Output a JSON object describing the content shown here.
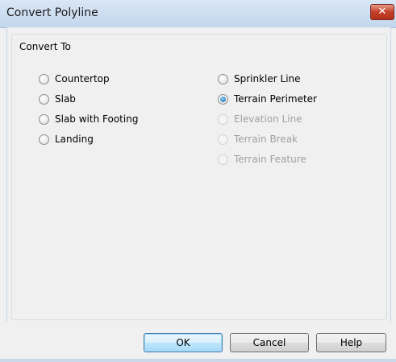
{
  "window": {
    "title": "Convert Polyline",
    "close_icon": "close-icon",
    "close_glyph": "✕"
  },
  "group": {
    "legend": "Convert To"
  },
  "options": {
    "countertop": "Countertop",
    "slab": "Slab",
    "slab_with_footing": "Slab with Footing",
    "landing": "Landing",
    "sprinkler_line": "Sprinkler Line",
    "terrain_perimeter": "Terrain Perimeter",
    "elevation_line": "Elevation Line",
    "terrain_break": "Terrain Break",
    "terrain_feature": "Terrain Feature"
  },
  "selected_option": "Terrain Perimeter",
  "disabled_options": [
    "Elevation Line",
    "Terrain Break",
    "Terrain Feature"
  ],
  "buttons": {
    "ok": "OK",
    "cancel": "Cancel",
    "help": "Help"
  },
  "colors": {
    "title_bar": "#c3d6ec",
    "close_button": "#c2402a",
    "selected_radio": "#1a5fa8"
  }
}
